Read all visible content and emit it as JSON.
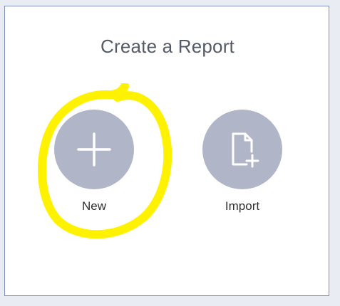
{
  "dialog": {
    "title": "Create a Report",
    "options": [
      {
        "label": "New",
        "icon": "plus-icon"
      },
      {
        "label": "Import",
        "icon": "file-add-icon"
      }
    ]
  },
  "colors": {
    "circle": "#b0b6c8",
    "icon": "#ffffff",
    "highlight": "#fff200",
    "border": "#7f8fc2",
    "page_background": "#e9ecf3"
  }
}
